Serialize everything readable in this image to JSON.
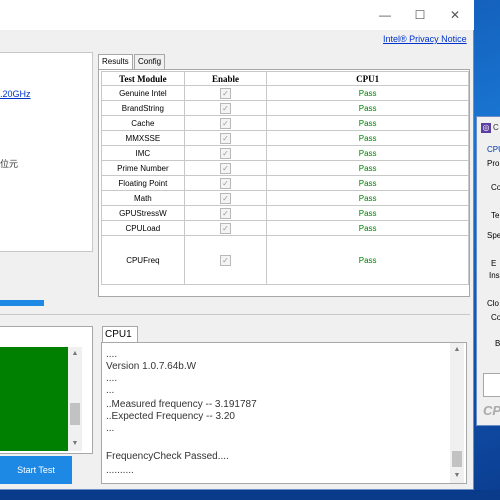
{
  "titlebar": {
    "minimize_glyph": "—",
    "maximize_glyph": "☐",
    "close_glyph": "✕"
  },
  "header": {
    "privacy_link": "Intel® Privacy Notice"
  },
  "left_panel": {
    "freq_text": ".20GHz",
    "unit_text": "位元"
  },
  "start_button": "Start Test",
  "tabs": [
    "Results",
    "Config"
  ],
  "table": {
    "headers": [
      "Test Module",
      "Enable",
      "CPU1"
    ],
    "rows": [
      {
        "module": "Genuine Intel",
        "result": "Pass"
      },
      {
        "module": "BrandString",
        "result": "Pass"
      },
      {
        "module": "Cache",
        "result": "Pass"
      },
      {
        "module": "MMXSSE",
        "result": "Pass"
      },
      {
        "module": "IMC",
        "result": "Pass"
      },
      {
        "module": "Prime Number",
        "result": "Pass"
      },
      {
        "module": "Floating Point",
        "result": "Pass"
      },
      {
        "module": "Math",
        "result": "Pass"
      },
      {
        "module": "GPUStressW",
        "result": "Pass"
      },
      {
        "module": "CPULoad",
        "result": "Pass"
      },
      {
        "module": "CPUFreq",
        "result": "Pass"
      }
    ]
  },
  "log": {
    "tab": "CPU1",
    "lines": [
      "....",
      "Version 1.0.7.64b.W",
      "....",
      "...",
      "..Measured frequency -- 3.191787",
      "..Expected Frequency -- 3.20",
      "...",
      "",
      "FrequencyCheck Passed....",
      ".........."
    ]
  },
  "right_window": {
    "title_initial": "C",
    "labels": [
      "CPU",
      "Pro",
      "Co",
      "Te",
      "Spe",
      "E",
      "Ins",
      "Clo",
      "Co",
      "B",
      "CPU"
    ]
  },
  "colors": {
    "accent": "#1e88e5",
    "pass": "#008000",
    "link": "#0033cc"
  }
}
